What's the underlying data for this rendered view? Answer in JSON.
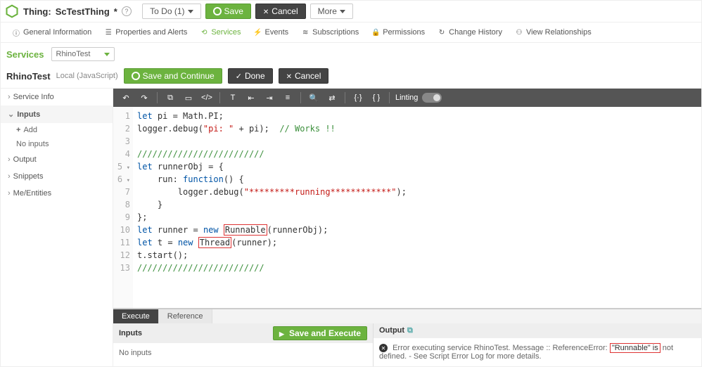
{
  "header": {
    "entity_type": "Thing:",
    "entity_name": "ScTestThing",
    "dirty_marker": "*",
    "status_label": "To Do (1)",
    "save_label": "Save",
    "cancel_label": "Cancel",
    "more_label": "More"
  },
  "tabs": [
    {
      "label": "General Information",
      "icon": "info-icon"
    },
    {
      "label": "Properties and Alerts",
      "icon": "list-icon"
    },
    {
      "label": "Services",
      "icon": "link-icon",
      "active": true
    },
    {
      "label": "Events",
      "icon": "bolt-icon"
    },
    {
      "label": "Subscriptions",
      "icon": "rss-icon"
    },
    {
      "label": "Permissions",
      "icon": "lock-icon"
    },
    {
      "label": "Change History",
      "icon": "refresh-icon"
    },
    {
      "label": "View Relationships",
      "icon": "graph-icon"
    }
  ],
  "services": {
    "title": "Services",
    "selected": "RhinoTest"
  },
  "service": {
    "name": "RhinoTest",
    "kind": "Local (JavaScript)",
    "save_continue_label": "Save and Continue",
    "done_label": "Done",
    "cancel_label": "Cancel"
  },
  "side": [
    {
      "label": "Service Info",
      "expanded": false
    },
    {
      "label": "Inputs",
      "expanded": true,
      "children": [
        {
          "label": "Add",
          "kind": "add"
        },
        {
          "label": "No inputs",
          "kind": "empty"
        }
      ]
    },
    {
      "label": "Output",
      "expanded": false
    },
    {
      "label": "Snippets",
      "expanded": false
    },
    {
      "label": "Me/Entities",
      "expanded": false
    }
  ],
  "toolbar": {
    "linting_label": "Linting"
  },
  "code": {
    "line_count": 13,
    "l1a": "let",
    "l1b": " pi = Math.PI;",
    "l2a": "logger.debug(",
    "l2b": "\"pi: \"",
    "l2c": " + pi);  ",
    "l2d": "// Works !!",
    "l4": "/////////////////////////",
    "l5a": "let",
    "l5b": " runnerObj = {",
    "l6a": "    run: ",
    "l6b": "function",
    "l6c": "() {",
    "l7a": "        logger.debug(",
    "l7b": "\"*********running************\"",
    "l7c": ");",
    "l8": "    }",
    "l9": "};",
    "l10a": "let",
    "l10b1": " runner = ",
    "l10b2": "new",
    "l10b3": " ",
    "l10box": "Runnable",
    "l10c": "(runnerObj);",
    "l11a": "let",
    "l11b1": " t = ",
    "l11b2": "new",
    "l11b3": " ",
    "l11box": "Thread",
    "l11c": "(runner);",
    "l12": "t.start();",
    "l13": "/////////////////////////"
  },
  "bottom": {
    "tabs": {
      "execute": "Execute",
      "reference": "Reference"
    },
    "inputs_title": "Inputs",
    "inputs_body": "No inputs",
    "save_execute_label": "Save and Execute",
    "output_title": "Output",
    "error_prefix": "Error executing service RhinoTest. Message :: ReferenceError: ",
    "error_boxed": "\"Runnable\" is",
    "error_suffix": " not defined. - See Script Error Log for more details."
  }
}
